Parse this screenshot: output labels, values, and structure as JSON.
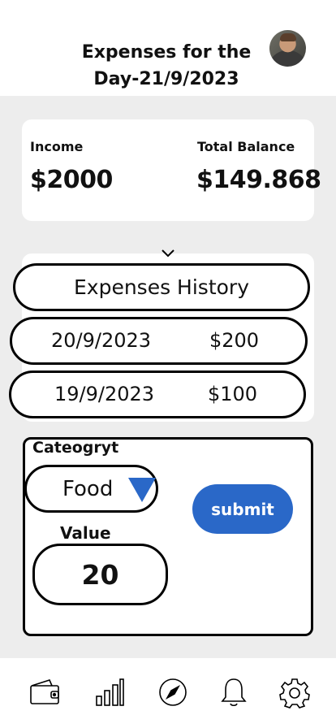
{
  "header": {
    "title": "Expenses for the Day-21/9/2023"
  },
  "summary": {
    "income_label": "Income",
    "income_value": "$2000",
    "balance_label": "Total Balance",
    "balance_value": "$149.868"
  },
  "history": {
    "title": "Expenses History",
    "items": [
      {
        "date": "20/9/2023",
        "amount": "$200"
      },
      {
        "date": "19/9/2023",
        "amount": "$100"
      }
    ]
  },
  "form": {
    "category_label": "Cateogryt",
    "category_value": "Food",
    "value_label": "Value",
    "value": "20",
    "submit_label": "submit"
  },
  "colors": {
    "accent": "#2a68c8",
    "background": "#ededed"
  },
  "nav": {
    "icons": [
      "wallet-icon",
      "bar-chart-icon",
      "compass-icon",
      "bell-icon",
      "gear-icon"
    ]
  }
}
